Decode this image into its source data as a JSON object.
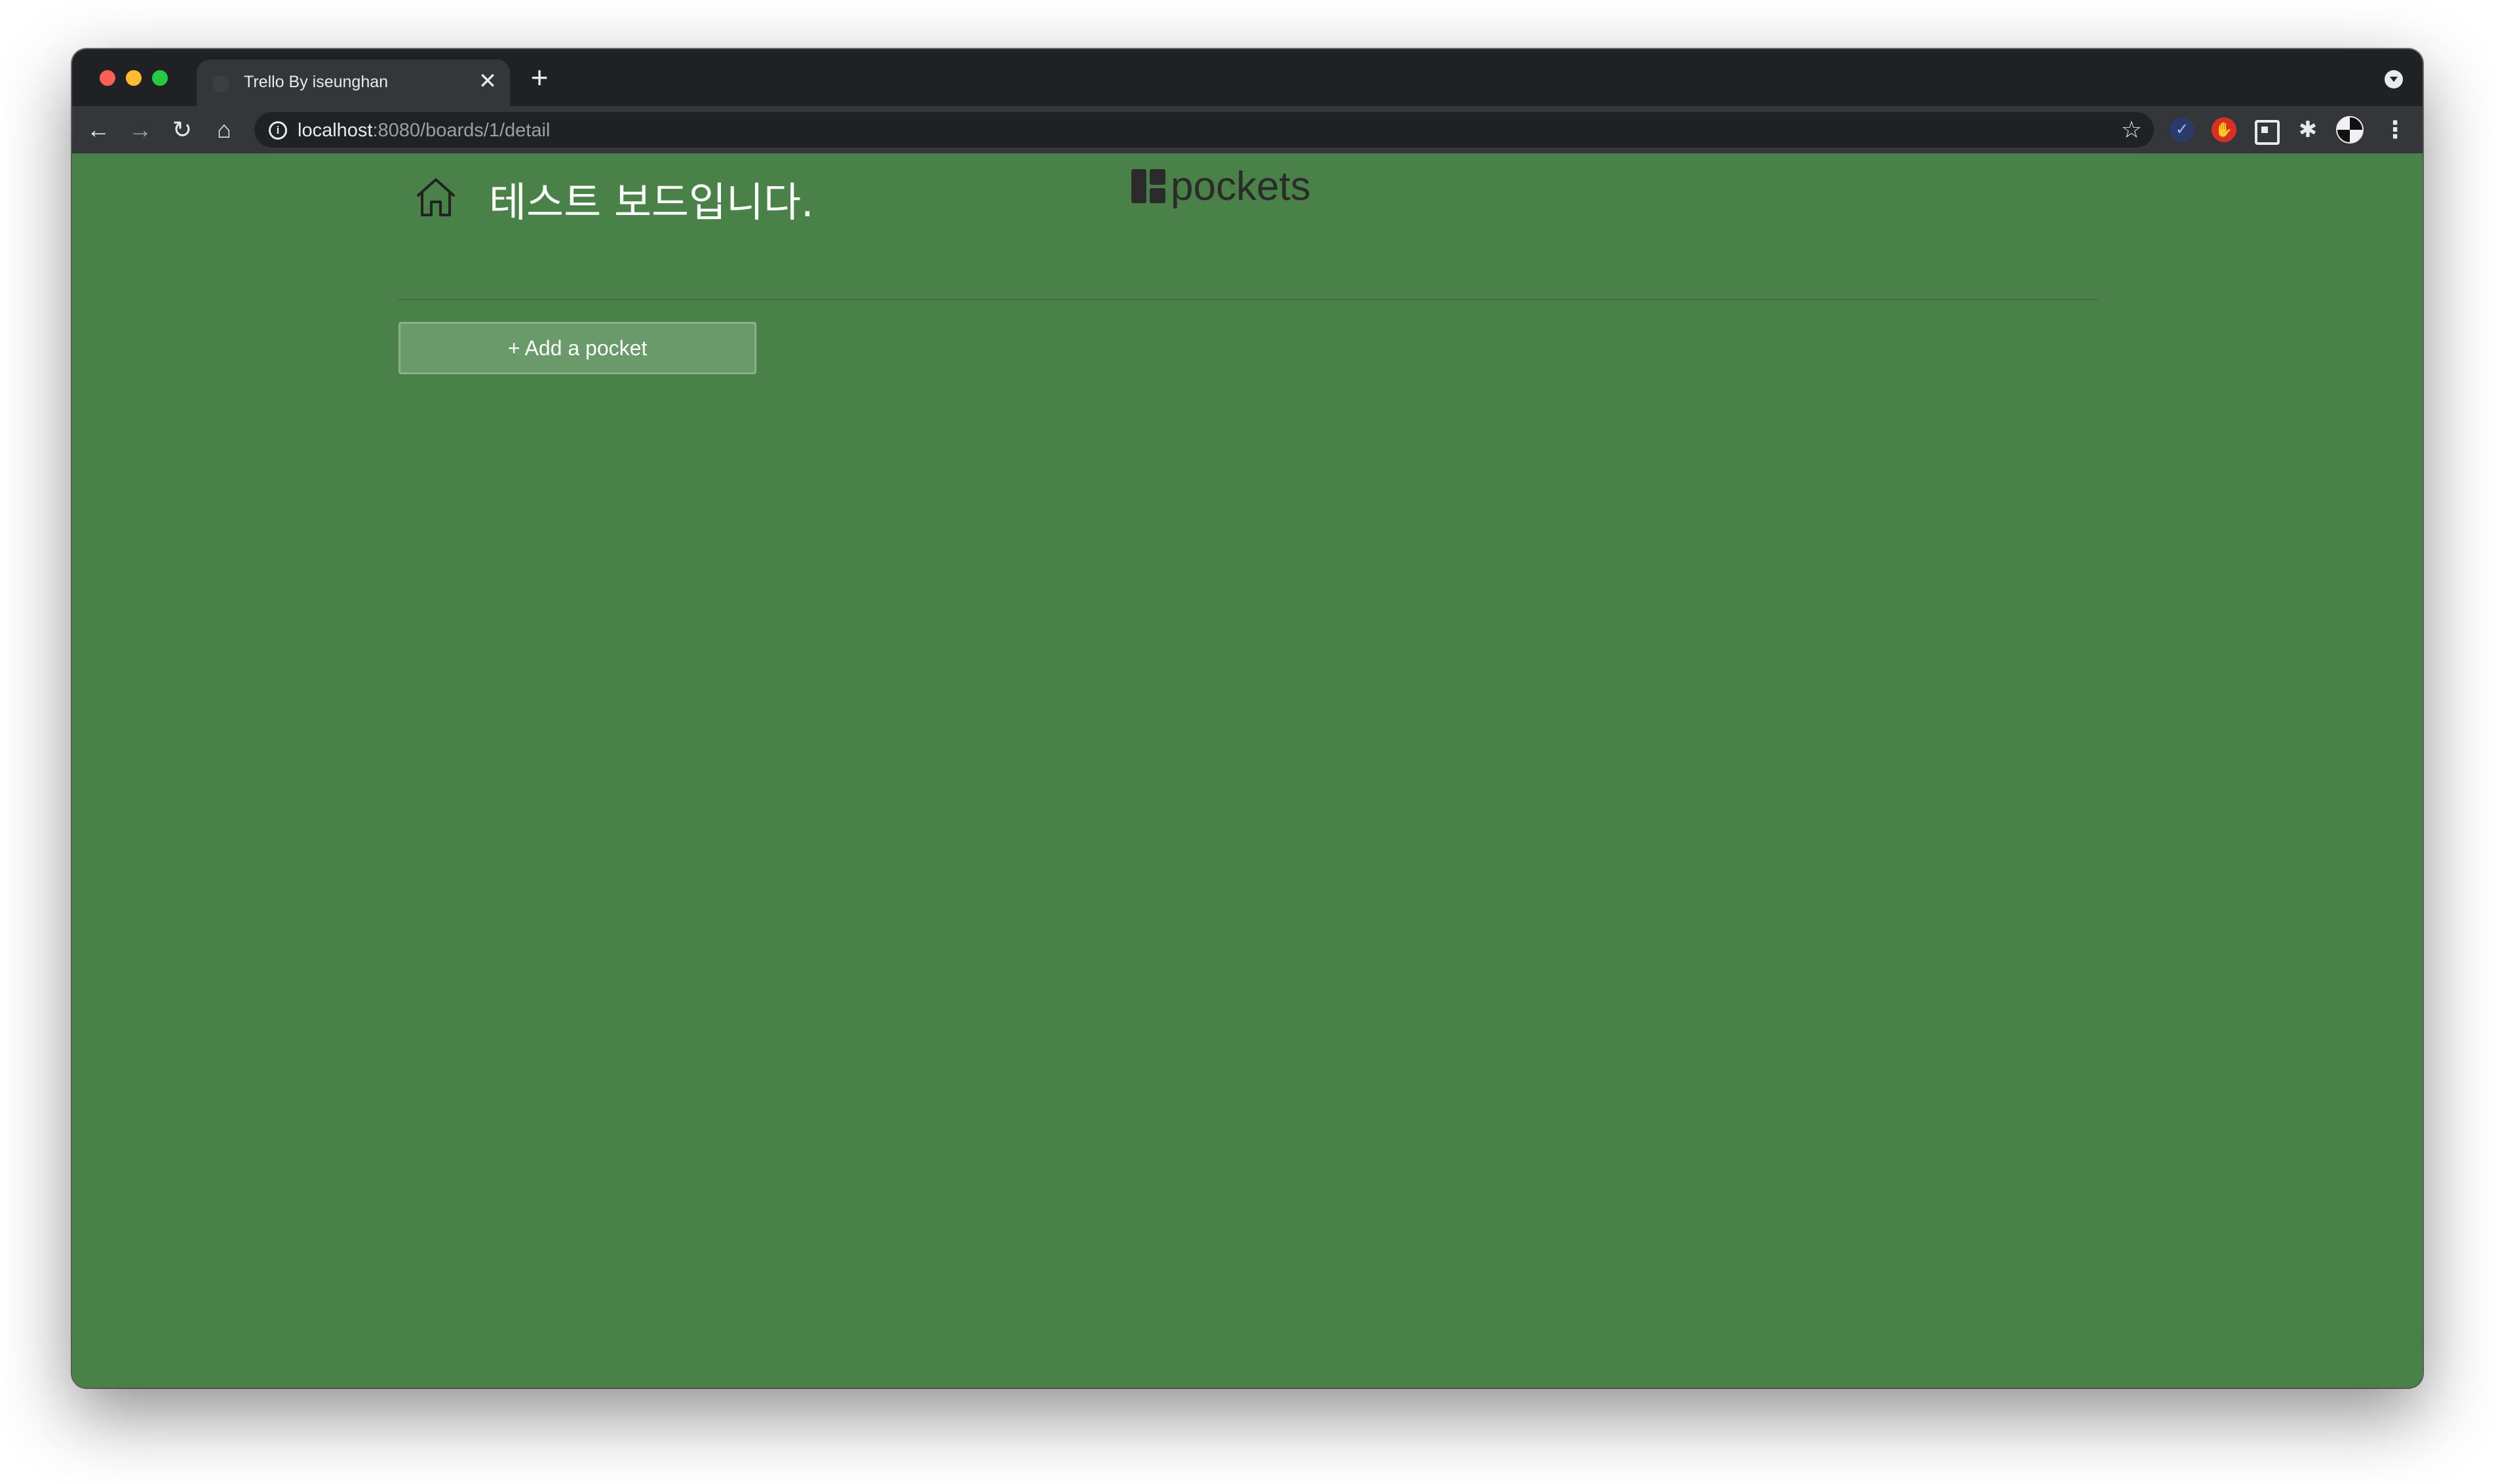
{
  "browser": {
    "tab": {
      "title": "Trello By iseunghan",
      "close_glyph": "✕"
    },
    "new_tab_glyph": "+",
    "nav": {
      "back_glyph": "←",
      "forward_glyph": "→",
      "reload_glyph": "↻",
      "home_glyph": "⌂"
    },
    "address_bar": {
      "host": "localhost",
      "path": ":8080/boards/1/detail",
      "info_glyph": "i",
      "star_glyph": "☆"
    },
    "extensions": {
      "check_glyph": "✓",
      "hand_glyph": "✋",
      "puzzle_glyph": "✱",
      "menu_glyph": "⋮"
    }
  },
  "page": {
    "board_title": "테스트 보드입니다.",
    "logo_text": "pockets",
    "add_pocket_label": "+ Add a pocket"
  },
  "colors": {
    "board_background": "#4a8149",
    "button_background": "#6a996a",
    "logo": "#2b2b2b"
  },
  "icons": {
    "home": "home-icon",
    "logo": "board-logo-icon"
  }
}
